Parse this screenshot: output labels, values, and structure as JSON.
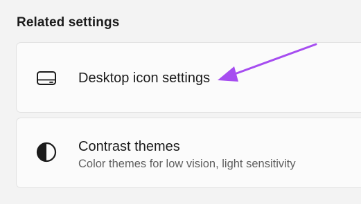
{
  "section": {
    "title": "Related settings"
  },
  "items": [
    {
      "label": "Desktop icon settings",
      "icon": "desktop-monitor-icon"
    },
    {
      "label": "Contrast themes",
      "description": "Color themes for low vision, light sensitivity",
      "icon": "contrast-half-circle-icon"
    }
  ],
  "annotation": {
    "icon": "pointer-arrow",
    "color": "#a64df0"
  }
}
